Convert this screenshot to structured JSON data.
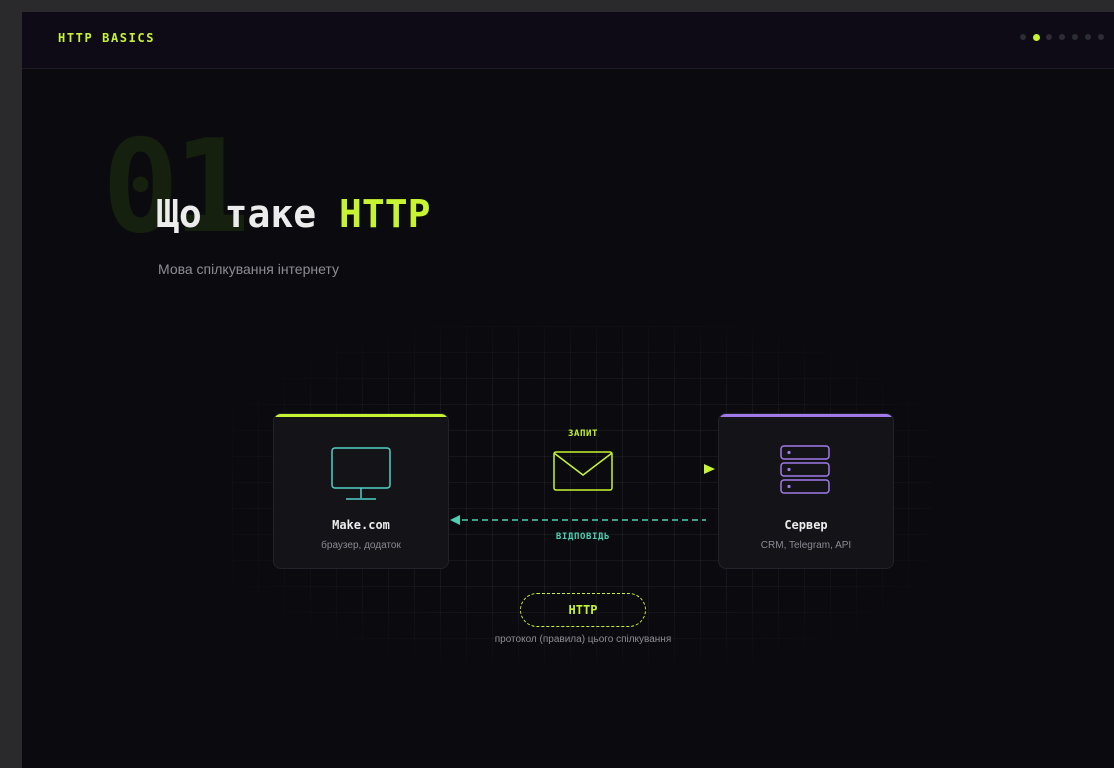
{
  "header": {
    "brand": "HTTP BASICS",
    "slides_total": 7,
    "slide_current": 2
  },
  "slide": {
    "number": "01",
    "title_prefix": "Що таке ",
    "title_accent": "HTTP",
    "subtitle": "Мова спілкування інтернету"
  },
  "diagram": {
    "client": {
      "title": "Make.com",
      "subtitle": "браузер, додаток",
      "icon": "monitor-icon"
    },
    "server": {
      "title": "Сервер",
      "subtitle": "CRM, Telegram, API",
      "icon": "server-icon"
    },
    "request_label": "ЗАПИТ",
    "response_label": "ВІДПОВІДЬ",
    "message_icon": "envelope-icon",
    "protocol_label": "HTTP",
    "protocol_caption": "протокол (правила) цього спілкування"
  },
  "colors": {
    "accent": "#c6f432",
    "response": "#4fcfb2",
    "client_icon": "#4fd1c5",
    "server": "#a07ae8",
    "background": "#0b0b0f"
  }
}
